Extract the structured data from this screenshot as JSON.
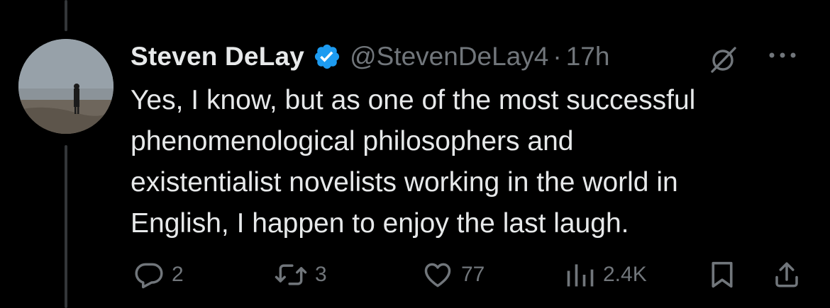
{
  "post": {
    "author": {
      "display_name": "Steven DeLay",
      "handle": "@StevenDeLay4",
      "verified": true,
      "verified_color": "#1d9bf0"
    },
    "separator": "·",
    "time": "17h",
    "text": "Yes, I know, but as one of the most successful\nphenomenological philosophers and\nexistentialist novelists working in the world in\nEnglish, I happen to enjoy the last laugh.",
    "actions": {
      "replies": "2",
      "reposts": "3",
      "likes": "77",
      "views": "2.4K"
    }
  },
  "icons": {
    "verified": "verified-badge-icon",
    "grok": "grok-icon",
    "more": "more-options-icon",
    "reply": "reply-icon",
    "repost": "repost-icon",
    "like": "heart-icon",
    "views": "analytics-icon",
    "bookmark": "bookmark-icon",
    "share": "share-icon"
  },
  "colors": {
    "background": "#000000",
    "text_primary": "#e7e9ea",
    "text_secondary": "#71767b",
    "thread_line": "#333639"
  }
}
